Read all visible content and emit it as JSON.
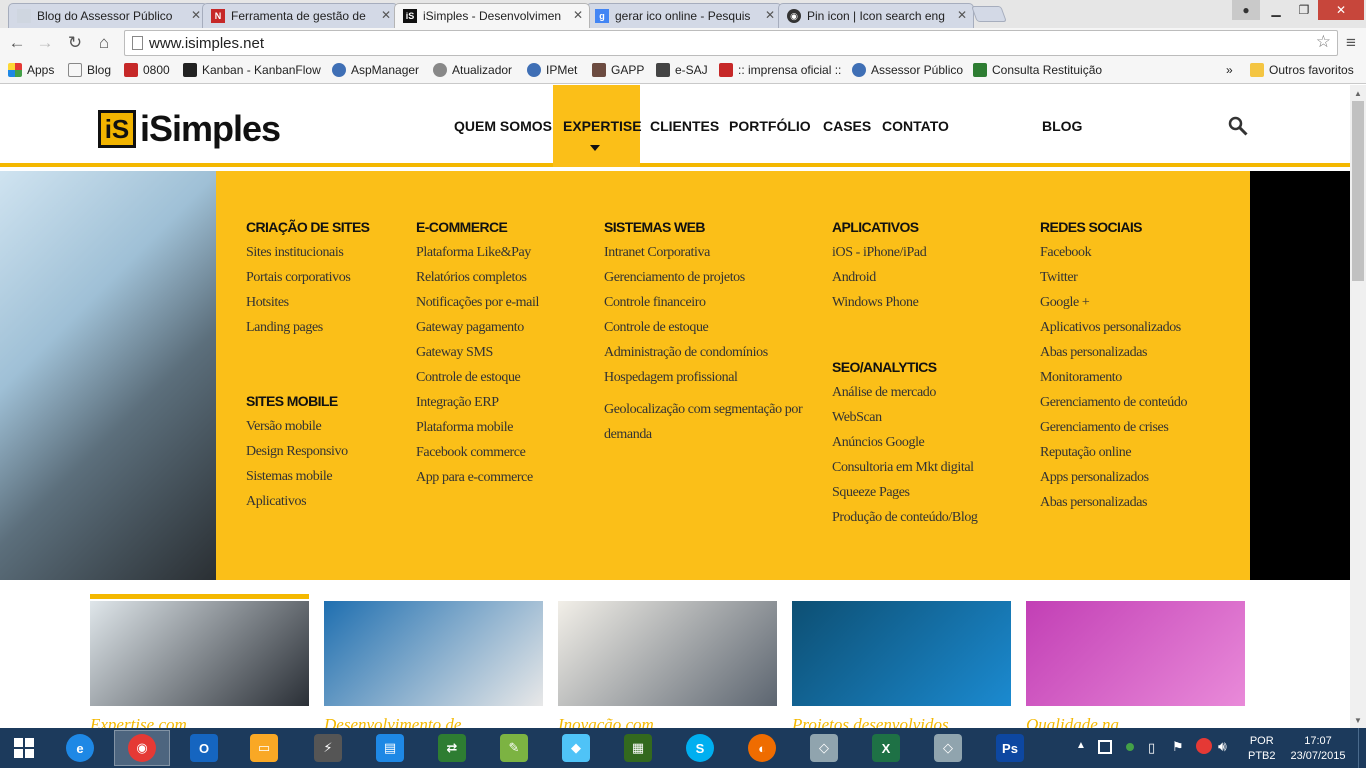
{
  "tabs": [
    {
      "title": "Blog do Assessor Público",
      "color": "#cfd6e0"
    },
    {
      "title": "Ferramenta de gestão de",
      "color": "#c62828"
    },
    {
      "title": "iSimples - Desenvolvimen",
      "color": "#111111"
    },
    {
      "title": "gerar ico online - Pesquis",
      "color": "#4285f4"
    },
    {
      "title": "Pin icon | Icon search eng",
      "color": "#333333"
    }
  ],
  "url": "www.isimples.net",
  "bookmarks": [
    {
      "label": "Apps",
      "color": "#e53935"
    },
    {
      "label": "Blog",
      "color": "#ffffff"
    },
    {
      "label": "0800",
      "color": "#c62828"
    },
    {
      "label": "Kanban - KanbanFlow",
      "color": "#222222"
    },
    {
      "label": "AspManager",
      "color": "#3f6fb5"
    },
    {
      "label": "Atualizador",
      "color": "#888888"
    },
    {
      "label": "IPMet",
      "color": "#3f6fb5"
    },
    {
      "label": "GAPP",
      "color": "#6d4c41"
    },
    {
      "label": "e-SAJ",
      "color": "#444444"
    },
    {
      "label": ":: imprensa oficial ::",
      "color": "#c62828"
    },
    {
      "label": "Assessor Público",
      "color": "#3f6fb5"
    },
    {
      "label": "Consulta Restituição",
      "color": "#2e7d32"
    }
  ],
  "bookmarks_more": "»",
  "other_bookmarks": "Outros favoritos",
  "site": {
    "logo_mark": "iS",
    "logo_text": "iSimples",
    "nav": [
      "QUEM SOMOS",
      "EXPERTISE",
      "CLIENTES",
      "PORTFÓLIO",
      "CASES",
      "CONTATO",
      "BLOG"
    ],
    "accent": "#fbbf18"
  },
  "menu": {
    "criacao": {
      "title": "CRIAÇÃO DE SITES",
      "items": [
        "Sites institucionais",
        "Portais corporativos",
        "Hotsites",
        "Landing pages"
      ]
    },
    "mobile": {
      "title": "SITES MOBILE",
      "items": [
        "Versão mobile",
        "Design Responsivo",
        "Sistemas mobile",
        "Aplicativos"
      ]
    },
    "ecommerce": {
      "title": "E-COMMERCE",
      "items": [
        "Plataforma Like&Pay",
        "Relatórios completos",
        "Notificações por e-mail",
        "Gateway pagamento",
        "Gateway SMS",
        "Controle de estoque",
        "Integração ERP",
        "Plataforma mobile",
        "Facebook commerce",
        "App para e-commerce"
      ]
    },
    "sistemas": {
      "title": "SISTEMAS WEB",
      "items": [
        "Intranet Corporativa",
        "Gerenciamento de projetos",
        "Controle financeiro",
        "Controle de estoque",
        "Administração de condomínios",
        "Hospedagem profissional"
      ],
      "geo": [
        "Geolocalização com segmentação por",
        "demanda"
      ]
    },
    "aplicativos": {
      "title": "APLICATIVOS",
      "items": [
        "iOS - iPhone/iPad",
        "Android",
        "Windows Phone"
      ]
    },
    "seo": {
      "title": "SEO/ANALYTICS",
      "items": [
        "Análise de mercado",
        "WebScan",
        "Anúncios Google",
        "Consultoria em Mkt digital",
        "Squeeze Pages",
        "Produção de conteúdo/Blog"
      ]
    },
    "redes": {
      "title": "REDES SOCIAIS",
      "items": [
        "Facebook",
        "Twitter",
        "Google +",
        "Aplicativos personalizados",
        "Abas personalizadas",
        "Monitoramento",
        "Gerenciamento de conteúdo",
        "Gerenciamento de crises",
        "Reputação online",
        "Apps personalizados",
        "Abas personalizadas"
      ]
    }
  },
  "thumbs": [
    {
      "caption": "Expertise com",
      "c1": "#dfe6ea",
      "c2": "#2a2f36"
    },
    {
      "caption": "Desenvolvimento de",
      "c1": "#1f6fb0",
      "c2": "#e8e8e8"
    },
    {
      "caption": "Inovação com",
      "c1": "#f2efe8",
      "c2": "#5c6570"
    },
    {
      "caption": "Projetos desenvolvidos",
      "c1": "#0d4f73",
      "c2": "#1b8ad0"
    },
    {
      "caption": "Qualidade na",
      "c1": "#c23fb5",
      "c2": "#e98ad9"
    }
  ],
  "taskbar": {
    "lang1": "POR",
    "lang2": "PTB2",
    "time": "17:07",
    "date": "23/07/2015",
    "apps": [
      {
        "name": "ie",
        "label": "e",
        "color": "#1e88e5"
      },
      {
        "name": "chrome",
        "label": "◉",
        "color": "#e53935"
      },
      {
        "name": "outlook",
        "label": "O",
        "color": "#1565c0"
      },
      {
        "name": "explorer",
        "label": "▭",
        "color": "#f9a825"
      },
      {
        "name": "winamp",
        "label": "⚡",
        "color": "#555555"
      },
      {
        "name": "app6",
        "label": "▤",
        "color": "#1e88e5"
      },
      {
        "name": "app7",
        "label": "⇄",
        "color": "#2e7d32"
      },
      {
        "name": "app8",
        "label": "✎",
        "color": "#7cb342"
      },
      {
        "name": "app9",
        "label": "◆",
        "color": "#4fc3f7"
      },
      {
        "name": "app10",
        "label": "▦",
        "color": "#33691e"
      },
      {
        "name": "skype",
        "label": "S",
        "color": "#00aff0"
      },
      {
        "name": "app12",
        "label": "◐",
        "color": "#ef6c00"
      },
      {
        "name": "app13",
        "label": "◇",
        "color": "#90a4ae"
      },
      {
        "name": "excel",
        "label": "X",
        "color": "#1e7145"
      },
      {
        "name": "app15",
        "label": "◇",
        "color": "#90a4ae"
      },
      {
        "name": "photoshop",
        "label": "Ps",
        "color": "#0d47a1"
      }
    ]
  }
}
